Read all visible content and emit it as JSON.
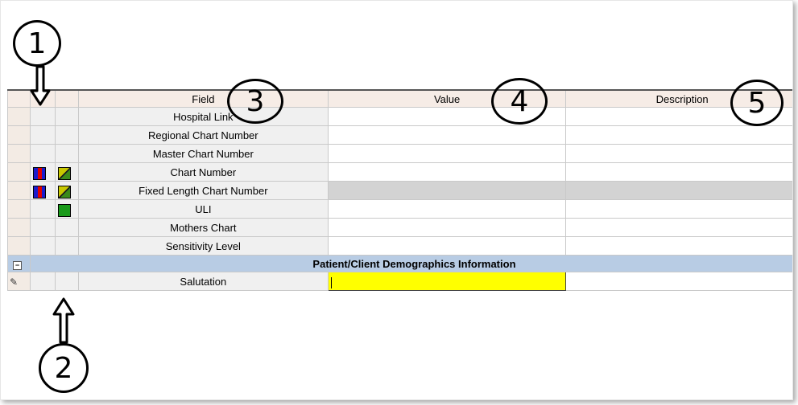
{
  "grid": {
    "columns": [
      "",
      "",
      "Field",
      "Value",
      "Description"
    ],
    "rows": [
      {
        "field": "Hospital Link",
        "icons": []
      },
      {
        "field": "Regional Chart Number",
        "icons": []
      },
      {
        "field": "Master Chart Number",
        "icons": []
      },
      {
        "field": "Chart Number",
        "icons": [
          "blue-red-icon",
          "yellow-green-diagonal-icon"
        ]
      },
      {
        "field": "Fixed Length Chart Number",
        "icons": [
          "blue-red-icon",
          "yellow-green-diagonal-icon"
        ],
        "value_state": "disabled"
      },
      {
        "field": "ULI",
        "icons": [
          "green-square-icon"
        ]
      },
      {
        "field": "Mothers Chart",
        "icons": []
      },
      {
        "field": "Sensitivity Level",
        "icons": []
      }
    ],
    "group_header": "Patient/Client Demographics Information",
    "edit_row": {
      "field": "Salutation",
      "value": "",
      "value_highlight": "#ffff00"
    }
  },
  "callouts": [
    "1",
    "2",
    "3",
    "4",
    "5"
  ],
  "colors": {
    "header_bg": "#f6ece6",
    "group_bg": "#b8cce4",
    "highlight": "#ffff00",
    "icon_blue": "#1a1acc",
    "icon_red": "#e00000",
    "icon_green": "#1a9a1a"
  }
}
